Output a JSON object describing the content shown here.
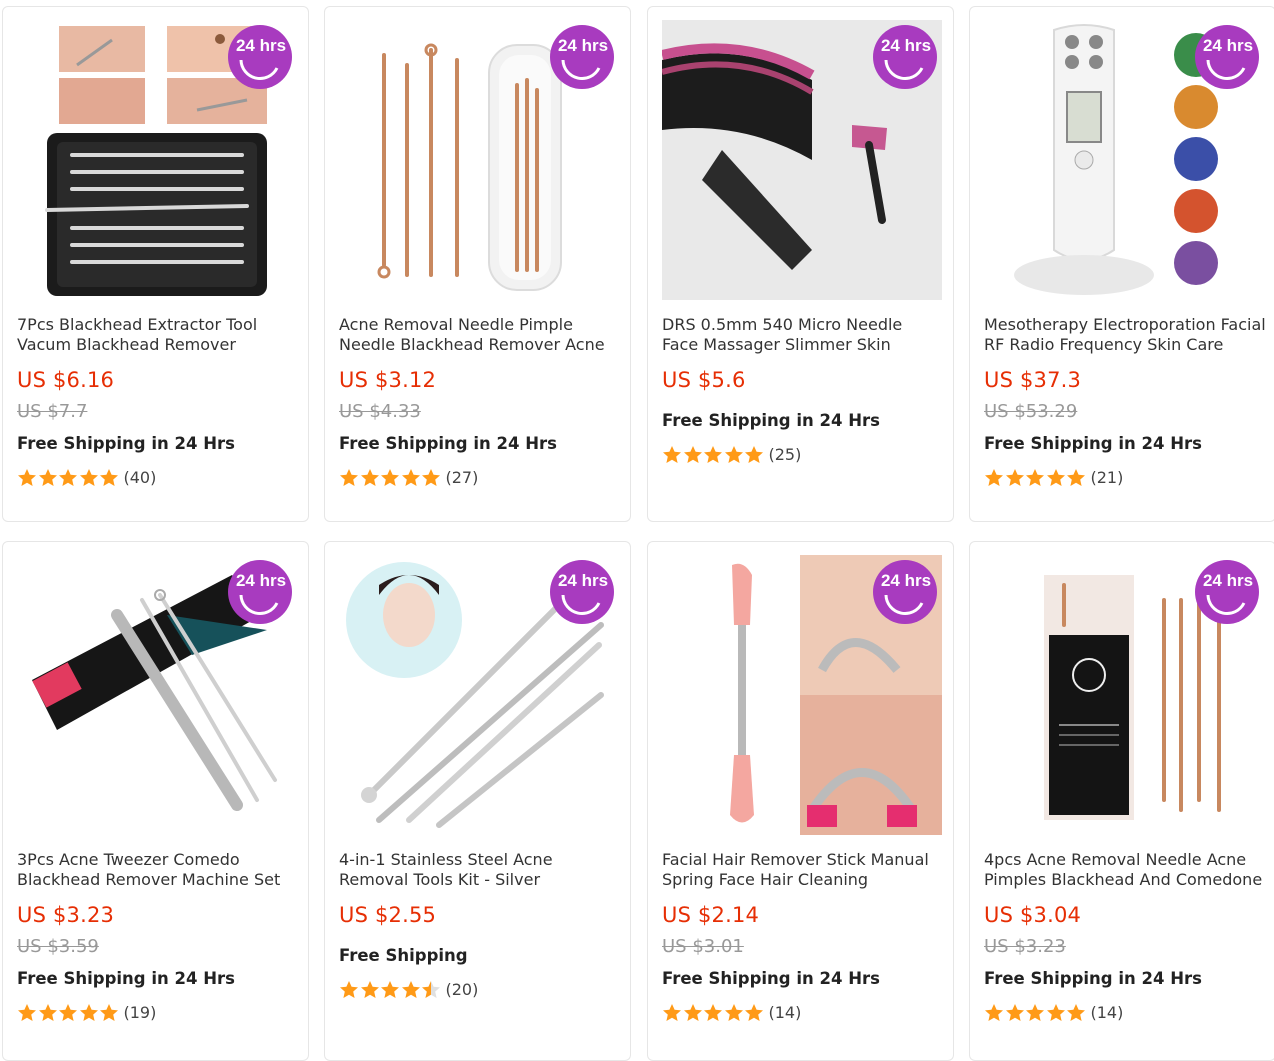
{
  "colors": {
    "price": "#e62e04",
    "star": "#ff9a17",
    "badge": "#a83bbf"
  },
  "badge_text": "24 hrs",
  "products": [
    {
      "title1": "7Pcs Blackhead Extractor Tool",
      "title2": "Vacum Blackhead Remover",
      "price": "US $6.16",
      "old_price": "US $7.7",
      "shipping": "Free Shipping in 24 Hrs",
      "reviews": "(40)",
      "stars": 5
    },
    {
      "title1": "Acne Removal Needle Pimple",
      "title2": "Needle Blackhead Remover Acne",
      "price": "US $3.12",
      "old_price": "US $4.33",
      "shipping": "Free Shipping in 24 Hrs",
      "reviews": "(27)",
      "stars": 5
    },
    {
      "title1": "DRS 0.5mm 540 Micro Needle",
      "title2": "Face Massager Slimmer Skin",
      "price": "US $5.6",
      "old_price": "",
      "shipping": "Free Shipping in 24 Hrs",
      "reviews": "(25)",
      "stars": 5
    },
    {
      "title1": "Mesotherapy Electroporation Facial",
      "title2": "RF Radio Frequency Skin Care",
      "price": "US $37.3",
      "old_price": "US $53.29",
      "shipping": "Free Shipping in 24 Hrs",
      "reviews": "(21)",
      "stars": 5
    },
    {
      "title1": "3Pcs Acne Tweezer Comedo",
      "title2": "Blackhead Remover Machine Set",
      "price": "US $3.23",
      "old_price": "US $3.59",
      "shipping": "Free Shipping in 24 Hrs",
      "reviews": "(19)",
      "stars": 5
    },
    {
      "title1": "4-in-1 Stainless Steel Acne",
      "title2": "Removal Tools Kit - Silver",
      "price": "US $2.55",
      "old_price": "",
      "shipping": "Free Shipping",
      "reviews": "(20)",
      "stars": 4.5
    },
    {
      "title1": "Facial Hair Remover Stick Manual",
      "title2": "Spring Face Hair Cleaning",
      "price": "US $2.14",
      "old_price": "US $3.01",
      "shipping": "Free Shipping in 24 Hrs",
      "reviews": "(14)",
      "stars": 5
    },
    {
      "title1": "4pcs Acne Removal Needle Acne",
      "title2": "Pimples Blackhead And Comedone",
      "price": "US $3.04",
      "old_price": "US $3.23",
      "shipping": "Free Shipping in 24 Hrs",
      "reviews": "(14)",
      "stars": 5
    }
  ]
}
